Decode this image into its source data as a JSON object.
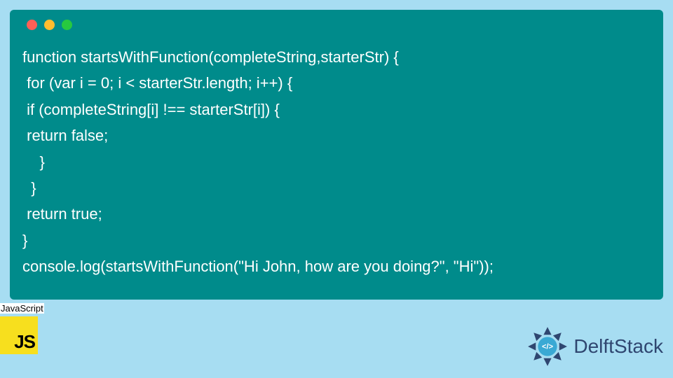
{
  "code": {
    "lines": [
      "function startsWithFunction(completeString,starterStr) {",
      " for (var i = 0; i < starterStr.length; i++) {",
      " if (completeString[i] !== starterStr[i]) {",
      " return false;",
      "    }",
      "  }",
      " return true;",
      "}",
      "console.log(startsWithFunction(\"Hi John, how are you doing?\", \"Hi\"));"
    ]
  },
  "language": {
    "label": "JavaScript",
    "logo_text": "JS"
  },
  "brand": {
    "name": "DelftStack"
  },
  "colors": {
    "code_bg": "#008b8b",
    "page_bg": "#a7ddf2",
    "js_yellow": "#f7df1e",
    "brand_blue": "#2f4670"
  }
}
